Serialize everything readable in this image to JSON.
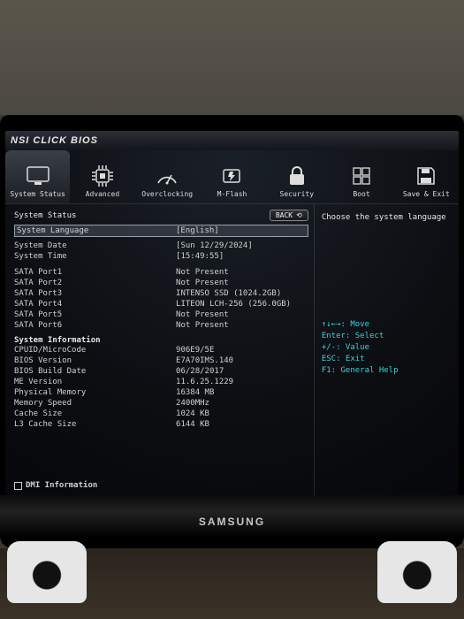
{
  "brand": "NSI  CLICK BIOS",
  "tabs": [
    {
      "label": "System Status"
    },
    {
      "label": "Advanced"
    },
    {
      "label": "Overclocking"
    },
    {
      "label": "M-Flash"
    },
    {
      "label": "Security"
    },
    {
      "label": "Boot"
    },
    {
      "label": "Save & Exit"
    }
  ],
  "back_label": "BACK",
  "page_heading": "System Status",
  "selected_row": {
    "label": "System Language",
    "value": "[English]"
  },
  "date_time": [
    {
      "k": "System Date",
      "v": "[Sun 12/29/2024]"
    },
    {
      "k": "System Time",
      "v": "[15:49:55]"
    }
  ],
  "sata": [
    {
      "k": "SATA Port1",
      "v": "Not Present"
    },
    {
      "k": "SATA Port2",
      "v": "Not Present"
    },
    {
      "k": "SATA Port3",
      "v": "INTENSO SSD  (1024.2GB)"
    },
    {
      "k": "SATA Port4",
      "v": "LITEON LCH-256 (256.0GB)"
    },
    {
      "k": "SATA Port5",
      "v": "Not Present"
    },
    {
      "k": "SATA Port6",
      "v": "Not Present"
    }
  ],
  "sysinfo_heading": "System Information",
  "sysinfo": [
    {
      "k": "CPUID/MicroCode",
      "v": "906E9/5E"
    },
    {
      "k": "BIOS Version",
      "v": "E7A70IMS.140"
    },
    {
      "k": "BIOS Build Date",
      "v": "06/28/2017"
    },
    {
      "k": "ME Version",
      "v": "11.6.25.1229"
    },
    {
      "k": "Physical Memory",
      "v": "16384 MB"
    },
    {
      "k": "Memory Speed",
      "v": "2400MHz"
    },
    {
      "k": "Cache Size",
      "v": "1024 KB"
    },
    {
      "k": "L3 Cache Size",
      "v": "6144 KB"
    }
  ],
  "dmi_label": "DMI Information",
  "help_title": "Choose the system language",
  "help_keys": [
    "↑↓←→: Move",
    "Enter: Select",
    "+/-: Value",
    "ESC: Exit",
    "F1: General Help"
  ],
  "monitor_brand": "SAMSUNG"
}
